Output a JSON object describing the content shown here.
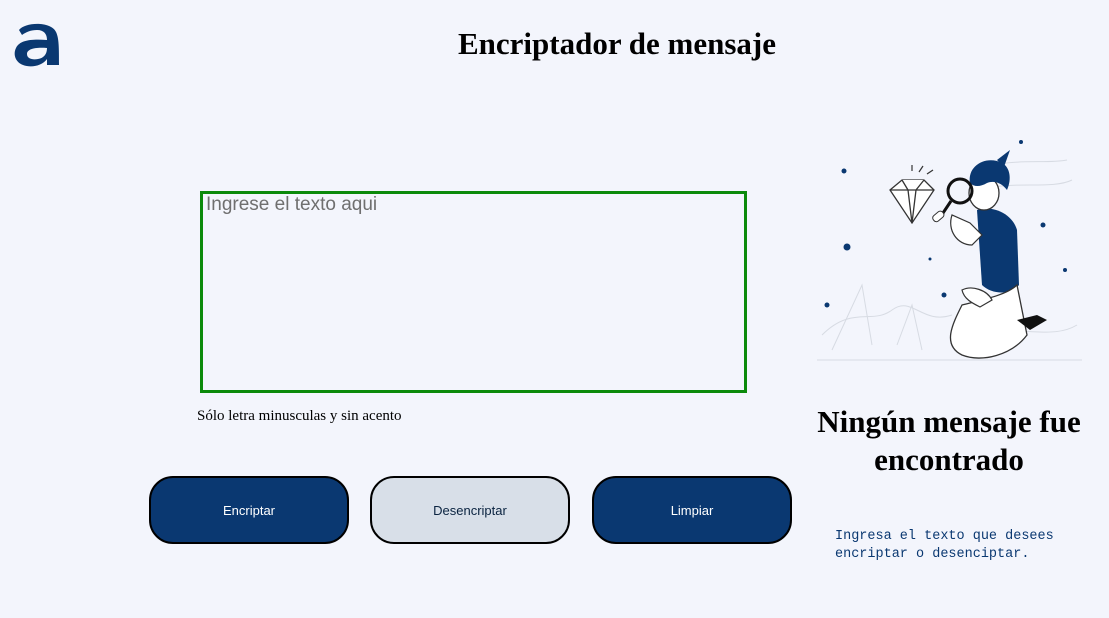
{
  "header": {
    "logo_icon": "alura-a-logo-icon",
    "title": "Encriptador de mensaje"
  },
  "input": {
    "value": "",
    "placeholder": "Ingrese el texto aqui",
    "hint": "Sólo letra minusculas y sin acento"
  },
  "buttons": {
    "encrypt_label": "Encriptar",
    "decrypt_label": "Desencriptar",
    "clear_label": "Limpiar"
  },
  "output": {
    "illustration_icon": "person-with-magnifying-glass-illustration",
    "empty_title": "Ningún mensaje fue encontrado",
    "empty_text": "Ingresa el texto que desees encriptar o desenciptar."
  },
  "colors": {
    "background": "#f3f5fc",
    "primary": "#0a3871",
    "secondary": "#d8dfe8",
    "input_border": "#0b8a0b"
  }
}
